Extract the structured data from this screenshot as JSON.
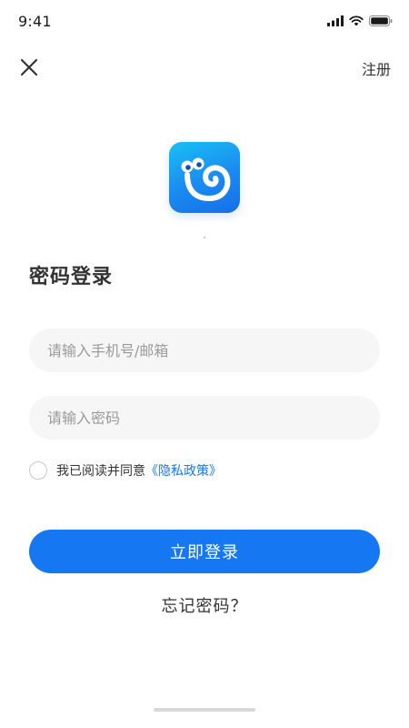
{
  "status_bar": {
    "time": "9:41",
    "icons": [
      "signal-icon",
      "wifi-icon",
      "battery-icon"
    ]
  },
  "header": {
    "close_icon": "close-icon",
    "register_label": "注册"
  },
  "logo": {
    "icon": "snail-logo-icon"
  },
  "title": "密码登录",
  "form": {
    "phone_placeholder": "请输入手机号/邮箱",
    "phone_value": "",
    "password_placeholder": "请输入密码",
    "password_value": "",
    "agree_text": "我已阅读并同意",
    "privacy_link": "《隐私政策》",
    "agree_checked": false
  },
  "login_button": "立即登录",
  "forgot_password": "忘记密码？",
  "colors": {
    "primary": "#1677f2",
    "link": "#1677ff",
    "input_bg": "#f6f6f7",
    "logo_gradient_start": "#19c0f5",
    "logo_gradient_end": "#1570e6"
  }
}
